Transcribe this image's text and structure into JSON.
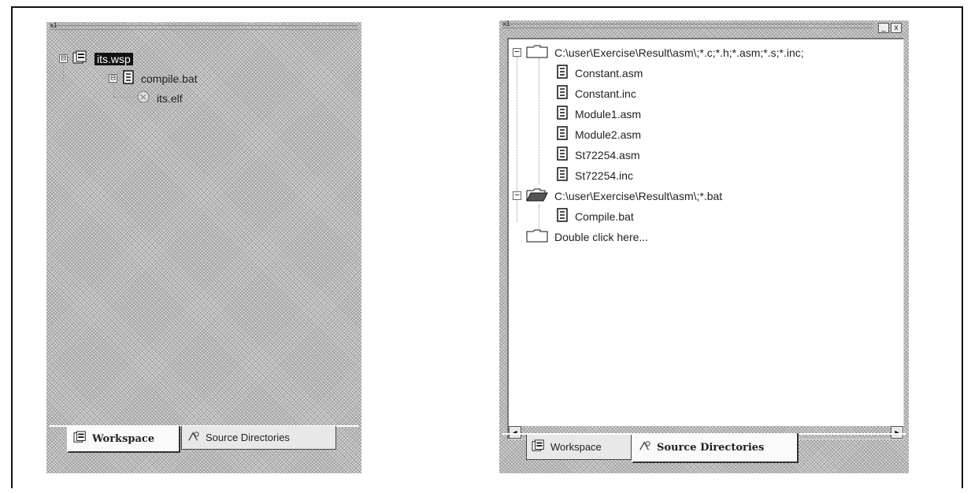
{
  "left_panel": {
    "grip_label": "x1",
    "tree": [
      {
        "label": "its.wsp",
        "icon": "workspace-icon",
        "expander": "⊟",
        "selected": true
      },
      {
        "label": "compile.bat",
        "icon": "document-icon",
        "expander": "⊟"
      },
      {
        "label": "its.elf",
        "icon": "elf-file-icon"
      }
    ],
    "tabs": {
      "workspace": "Workspace",
      "source_directories": "Source Directories"
    }
  },
  "right_panel": {
    "grip_label": "x1",
    "title_buttons": {
      "restore": "_",
      "close": "x"
    },
    "tree": {
      "folder1": "C:\\user\\Exercise\\Result\\asm\\;*.c;*.h;*.asm;*.s;*.inc;",
      "folder1_files": [
        "Constant.asm",
        "Constant.inc",
        "Module1.asm",
        "Module2.asm",
        "St72254.asm",
        "St72254.inc"
      ],
      "folder2": "C:\\user\\Exercise\\Result\\asm\\;*.bat",
      "folder2_files": [
        "Compile.bat"
      ],
      "folder3": "Double click here..."
    },
    "scroll": {
      "left": "◄",
      "right": "►"
    },
    "tabs": {
      "workspace": "Workspace",
      "source_directories": "Source Directories"
    }
  }
}
